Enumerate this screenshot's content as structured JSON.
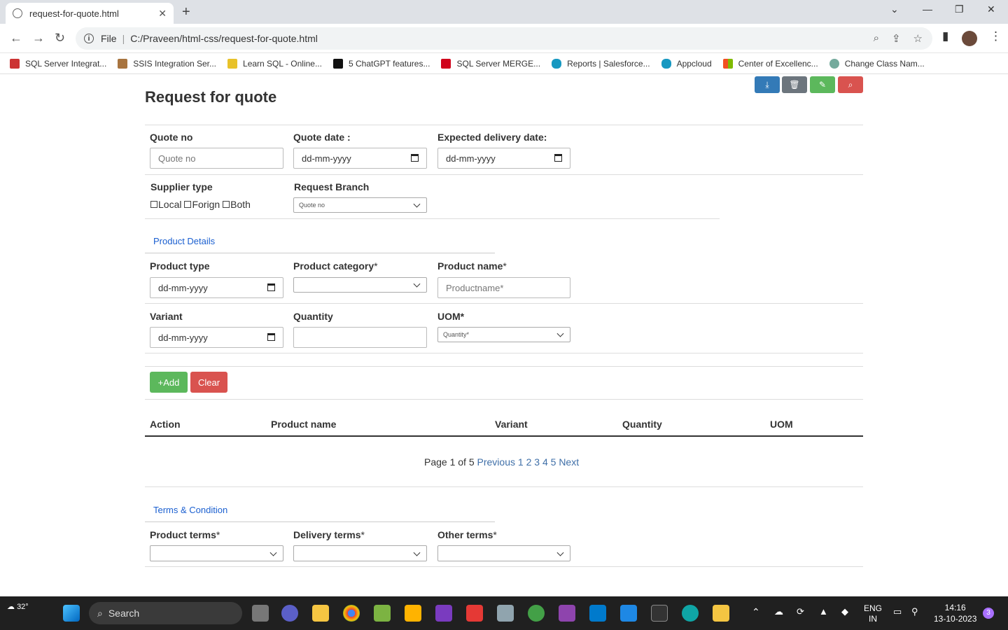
{
  "browser": {
    "tab_title": "request-for-quote.html",
    "url_scheme": "File",
    "url": "C:/Praveen/html-css/request-for-quote.html",
    "bookmarks": [
      {
        "label": "SQL Server Integrat...",
        "icon": "sql-server-icon"
      },
      {
        "label": "SSIS Integration Ser...",
        "icon": "ssis-icon"
      },
      {
        "label": "Learn SQL - Online...",
        "icon": "key-icon"
      },
      {
        "label": "5 ChatGPT features...",
        "icon": "video-icon"
      },
      {
        "label": "SQL Server MERGE...",
        "icon": "sqlshack-icon"
      },
      {
        "label": "Reports | Salesforce...",
        "icon": "salesforce-icon"
      },
      {
        "label": "Appcloud",
        "icon": "salesforce-icon"
      },
      {
        "label": "Center of Excellenc...",
        "icon": "microsoft-icon"
      },
      {
        "label": "Change Class Nam...",
        "icon": "chatgpt-icon"
      }
    ]
  },
  "page": {
    "title": "Request for quote",
    "action_buttons": [
      {
        "icon": "download-icon",
        "color": "#337ab7"
      },
      {
        "icon": "trash-icon",
        "color": "#6c757d"
      },
      {
        "icon": "edit-icon",
        "color": "#5cb85c"
      },
      {
        "icon": "search-icon",
        "color": "#d9534f"
      }
    ],
    "quote_no": {
      "label": "Quote no",
      "placeholder": "Quote no"
    },
    "quote_date": {
      "label": "Quote date :",
      "placeholder": "dd-mm-yyyy"
    },
    "expected_delivery": {
      "label": "Expected delivery date:",
      "placeholder": "dd-mm-yyyy"
    },
    "supplier_type": {
      "label": "Supplier type",
      "options": [
        "Local",
        "Forign",
        "Both"
      ]
    },
    "request_branch": {
      "label": "Request Branch",
      "selected": "Quote no"
    },
    "product_details_link": "Product Details",
    "product_type": {
      "label": "Product type",
      "placeholder": "dd-mm-yyyy"
    },
    "product_category": {
      "label": "Product category",
      "req": "*",
      "selected": ""
    },
    "product_name": {
      "label": "Product name",
      "req": "*",
      "placeholder": "Productname*"
    },
    "variant": {
      "label": "Variant",
      "placeholder": "dd-mm-yyyy"
    },
    "quantity": {
      "label": "Quantity",
      "value": ""
    },
    "uom": {
      "label": "UOM*",
      "selected": "Quantity*"
    },
    "add_button": "+Add",
    "clear_button": "Clear",
    "table_headers": [
      "Action",
      "Product name",
      "Variant",
      "Quantity",
      "UOM"
    ],
    "pager": {
      "text": "Page 1 of 5",
      "previous": "Previous",
      "pages": [
        "1",
        "2",
        "3",
        "4",
        "5"
      ],
      "next": "Next"
    },
    "terms_link": "Terms & Condition",
    "product_terms": {
      "label": "Product terms",
      "req": "*"
    },
    "delivery_terms": {
      "label": "Delivery terms",
      "req": "*"
    },
    "other_terms": {
      "label": "Other terms",
      "req": "*"
    }
  },
  "taskbar": {
    "weather": "32°",
    "search": "Search",
    "lang_line1": "ENG",
    "lang_line2": "IN",
    "time": "14:16",
    "date": "13-10-2023",
    "notifications": "3"
  }
}
